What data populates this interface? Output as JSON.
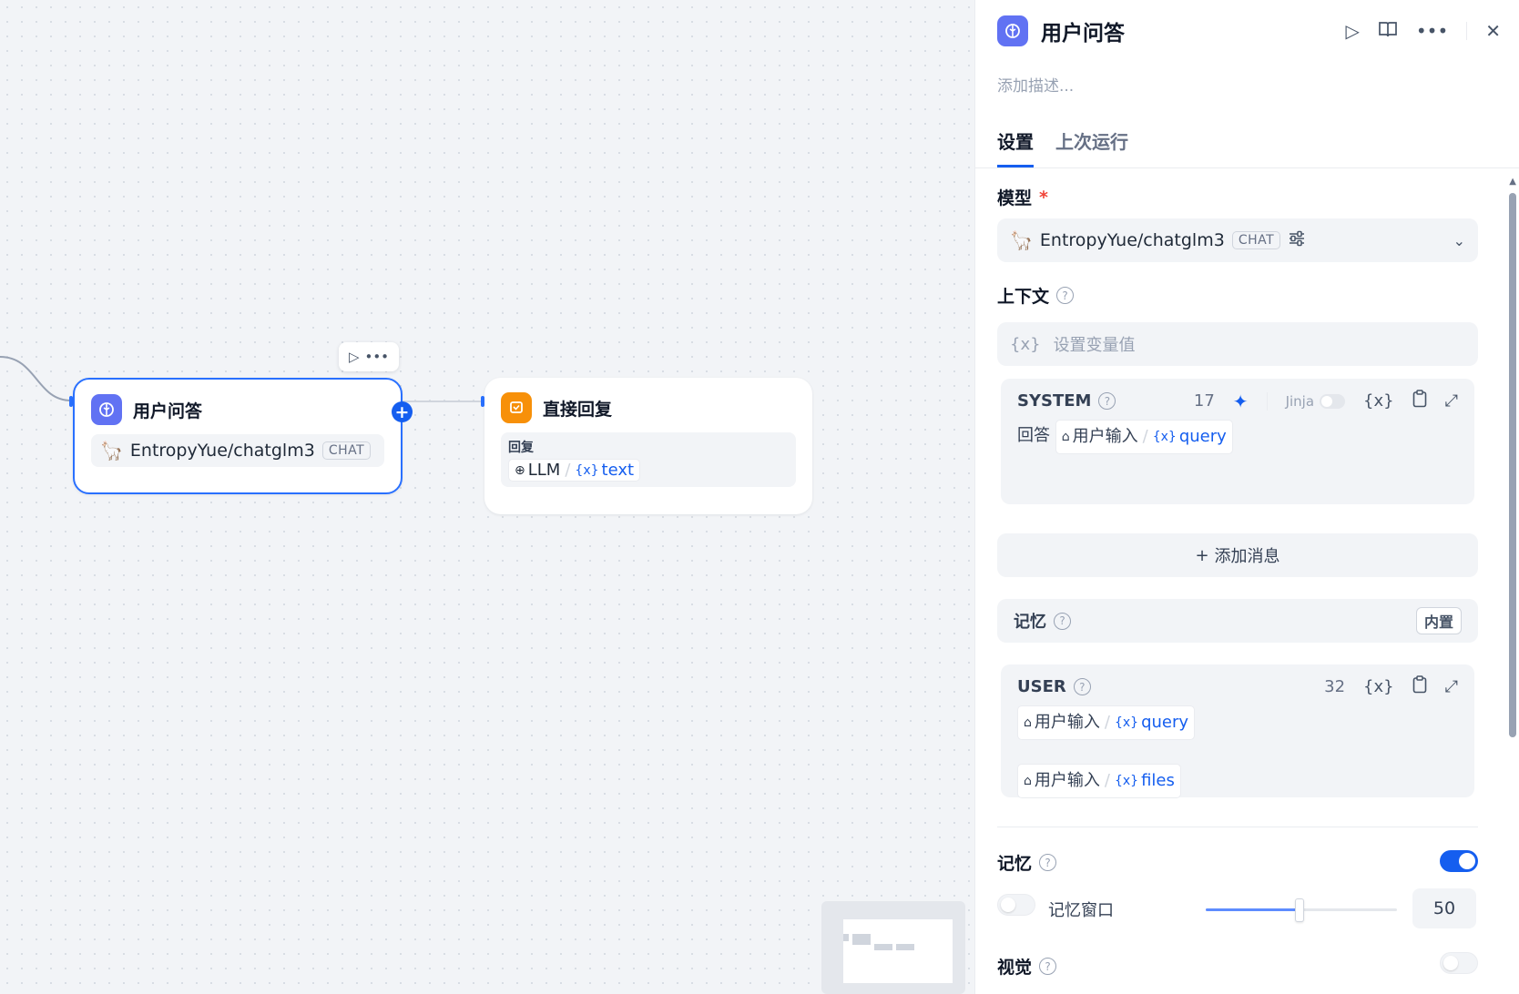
{
  "canvas": {
    "node_llm": {
      "title": "用户问答",
      "model_name": "EntropyYue/chatglm3",
      "model_badge": "CHAT",
      "icon": "brain-icon",
      "icon_color": "#6172f3"
    },
    "node_answer": {
      "title": "直接回复",
      "icon": "answer-icon",
      "icon_color": "#f79009",
      "reply_label": "回复",
      "var_source": "LLM",
      "var_sep": "/",
      "var_name": "text"
    },
    "toolbar": {
      "run_icon": "play-icon",
      "more_icon": "more-icon"
    },
    "add_handle": "+"
  },
  "panel": {
    "title": "用户问答",
    "description_placeholder": "添加描述...",
    "header_icons": [
      "play-icon",
      "book-icon",
      "more-icon",
      "close-icon"
    ],
    "tabs": [
      {
        "label": "设置",
        "active": true
      },
      {
        "label": "上次运行",
        "active": false
      }
    ],
    "model": {
      "label": "模型",
      "required_mark": "*",
      "name": "EntropyYue/chatglm3",
      "badge": "CHAT"
    },
    "context": {
      "label": "上下文",
      "var_icon": "{x}",
      "placeholder": "设置变量值"
    },
    "system_msg": {
      "role": "SYSTEM",
      "count": "17",
      "jinja_label": "Jinja",
      "var_icon": "{x}",
      "text_prefix": "回答",
      "chip_source": "用户输入",
      "chip_sep": "/",
      "chip_var": "query"
    },
    "add_message": {
      "plus": "+",
      "label": "添加消息"
    },
    "memory_block": {
      "label": "记忆",
      "badge": "内置"
    },
    "user_msg": {
      "role": "USER",
      "count": "32",
      "var_icon": "{x}",
      "chip1_source": "用户输入",
      "chip1_sep": "/",
      "chip1_var": "query",
      "chip2_source": "用户输入",
      "chip2_sep": "/",
      "chip2_var": "files"
    },
    "memory": {
      "label": "记忆",
      "enabled": true,
      "window_label": "记忆窗口",
      "window_enabled": false,
      "window_value": "50",
      "slider_fraction": 0.49
    },
    "vision": {
      "label": "视觉",
      "enabled": false
    },
    "colors": {
      "accent": "#155eef",
      "required": "#f04438"
    }
  }
}
